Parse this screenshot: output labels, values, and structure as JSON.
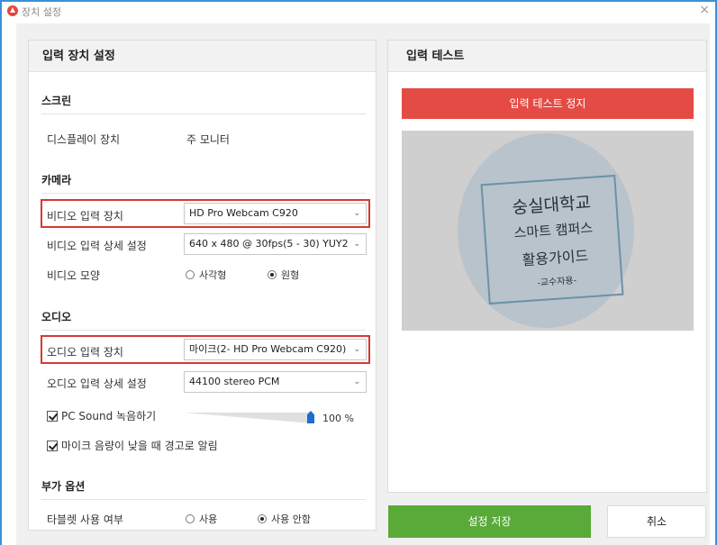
{
  "window": {
    "title": "장치 설정",
    "close_glyph": "×"
  },
  "settings": {
    "header": "입력 장치 설정",
    "screen": {
      "section": "스크린",
      "display_label": "디스플레이 장치",
      "display_value": "주 모니터"
    },
    "camera": {
      "section": "카메라",
      "video_device_label": "비디오 입력 장치",
      "video_device_value": "HD Pro Webcam C920",
      "video_detail_label": "비디오 입력 상세 설정",
      "video_detail_value": "640 x 480 @ 30fps(5 - 30) YUY2",
      "video_shape_label": "비디오 모양",
      "shape_options": [
        "사각형",
        "원형"
      ],
      "shape_selected": "원형"
    },
    "audio": {
      "section": "오디오",
      "audio_device_label": "오디오 입력 장치",
      "audio_device_value": "마이크(2- HD Pro Webcam C920)",
      "audio_detail_label": "오디오 입력 상세 설정",
      "audio_detail_value": "44100 stereo PCM",
      "pc_sound_label": "PC Sound 녹음하기",
      "pc_sound_checked": true,
      "volume_value": 100,
      "volume_label": "100 %",
      "mic_warning_label": "마이크 음량이 낮을 때 경고로 알림",
      "mic_warning_checked": true
    },
    "extra": {
      "section": "부가 옵션",
      "tablet_label": "타블렛 사용 여부",
      "tablet_options": [
        "사용",
        "사용 안함"
      ],
      "tablet_selected": "사용 안함"
    }
  },
  "test": {
    "header": "입력 테스트",
    "stop_button": "입력 테스트 정지",
    "preview_text": [
      "숭실대학교",
      "스마트 캠퍼스",
      "활용가이드",
      "-교수자용-"
    ]
  },
  "actions": {
    "save": "설정 저장",
    "cancel": "취소"
  },
  "colors": {
    "accent_red": "#e54b45",
    "save_green": "#5aaa3a",
    "window_border": "#3b8fd9",
    "highlight": "#d63a32"
  },
  "icons": {
    "app": "app-logo-icon",
    "close": "close-icon",
    "dropdown": "chevron-down-icon"
  }
}
